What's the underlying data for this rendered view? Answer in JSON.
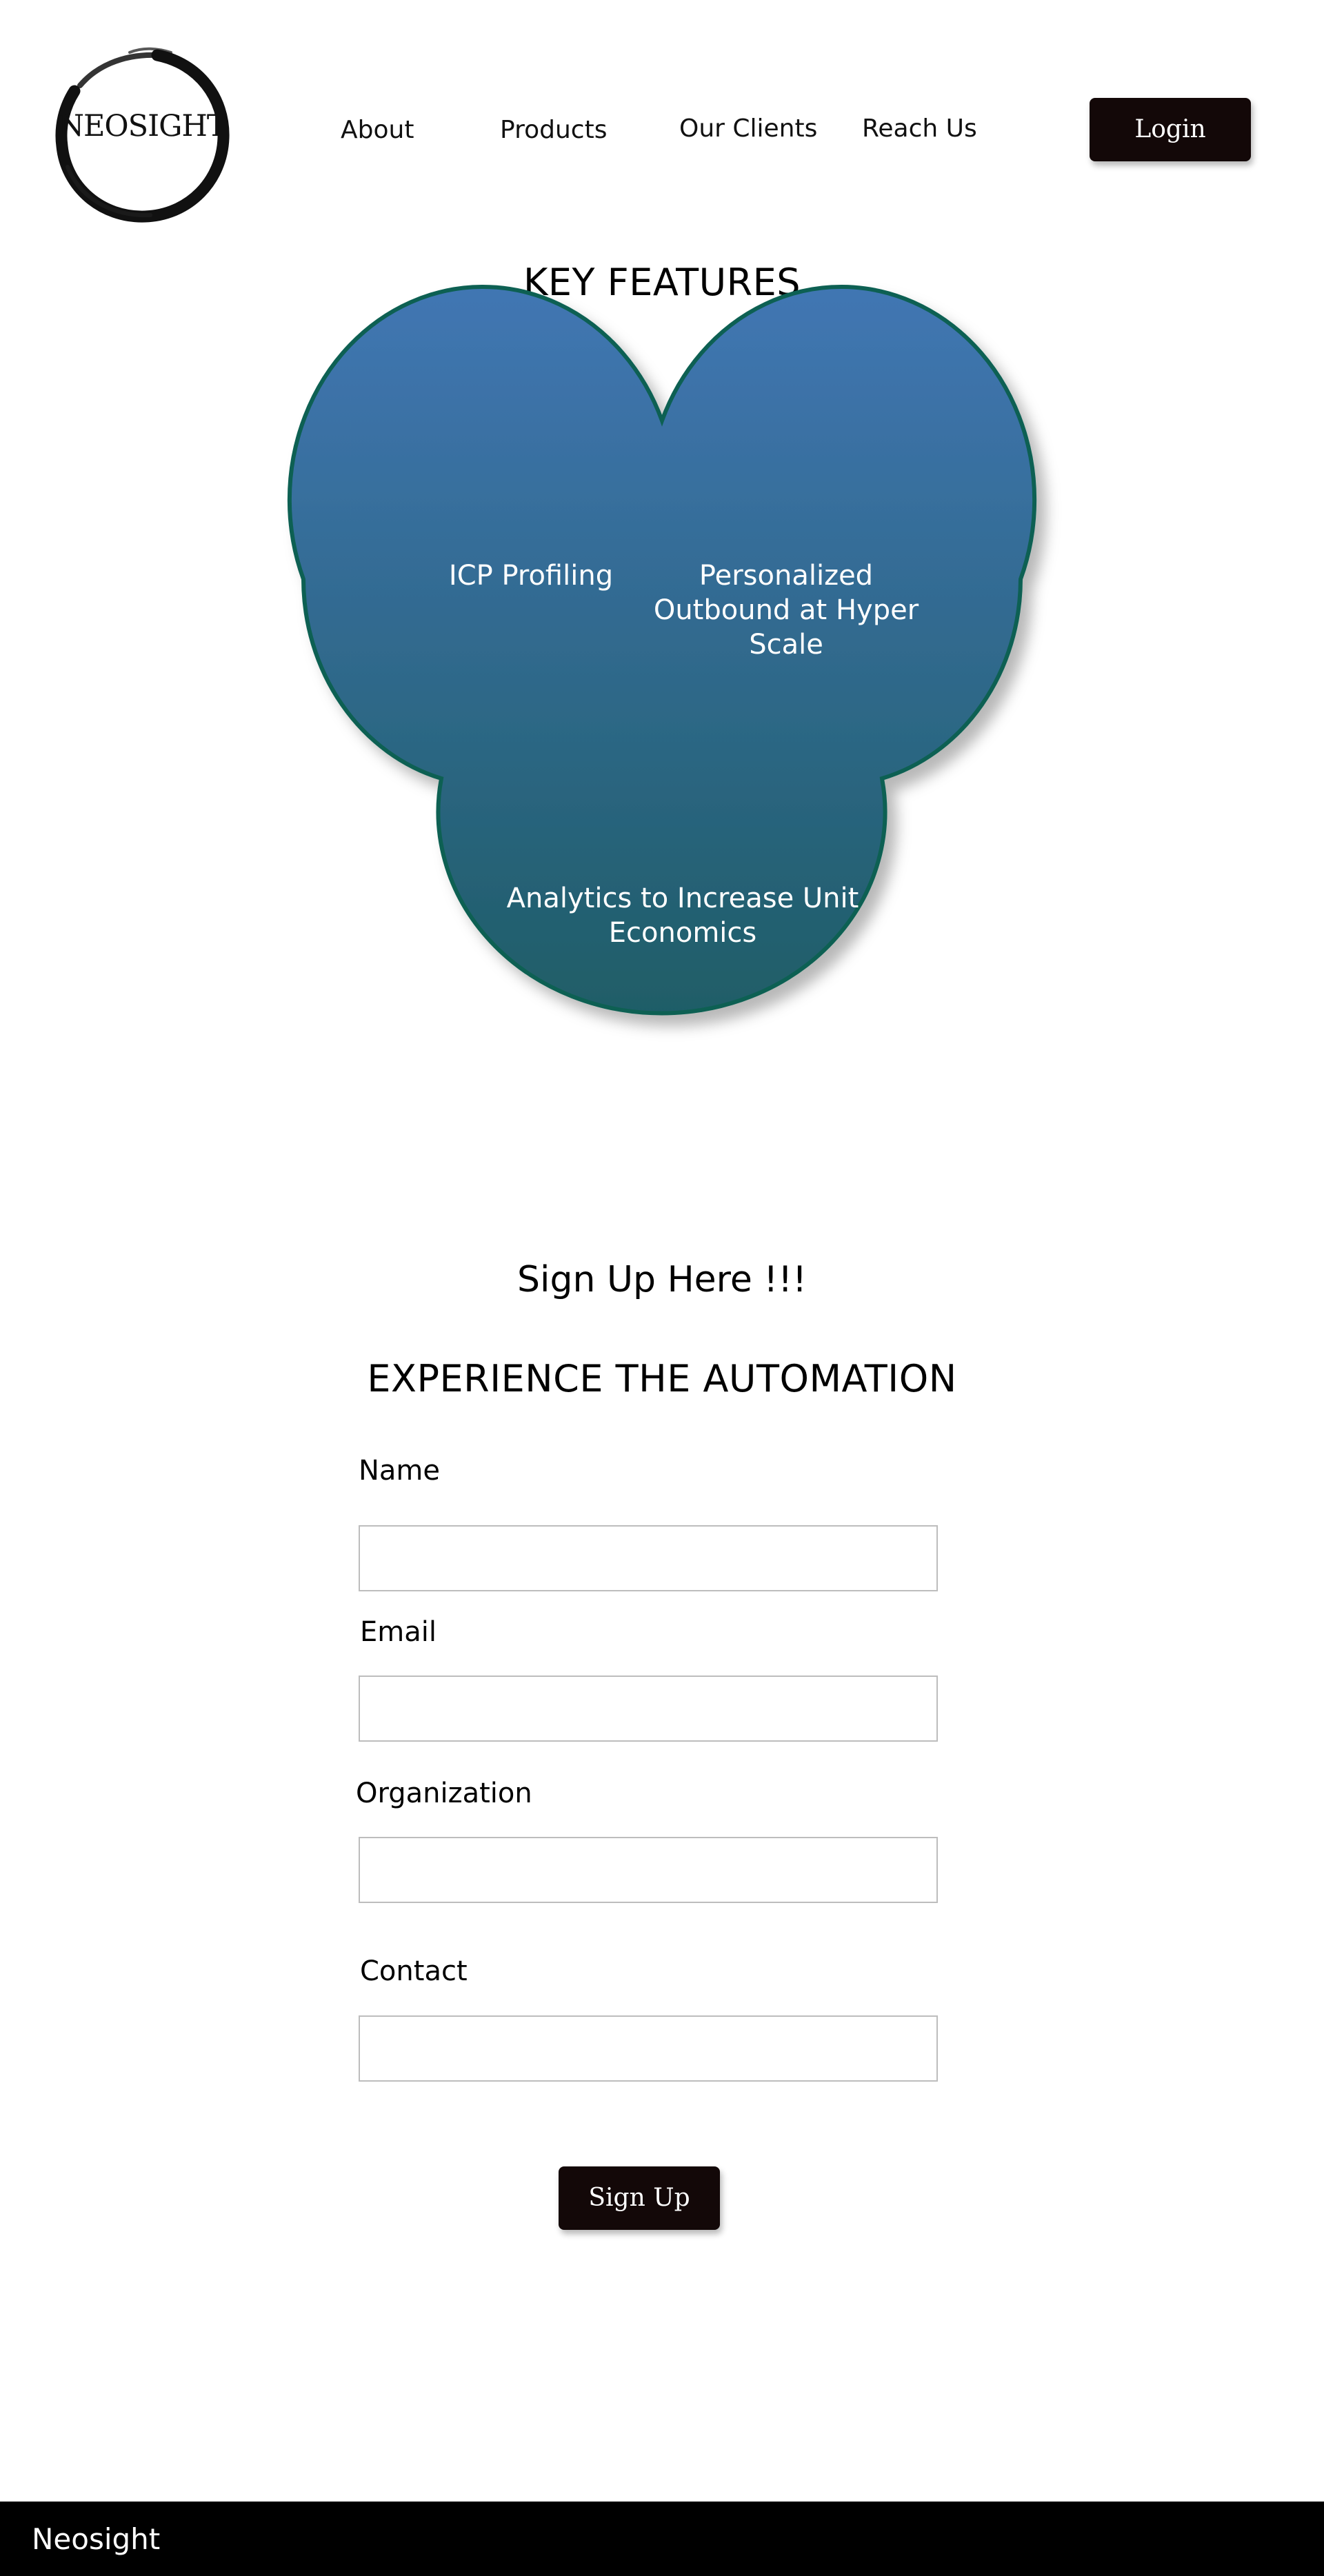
{
  "header": {
    "logo_text": "NEOSIGHT",
    "nav": {
      "about": "About",
      "products": "Products",
      "clients": "Our Clients",
      "reach": "Reach Us"
    },
    "login_label": "Login"
  },
  "features": {
    "title": "KEY FEATURES",
    "items": [
      {
        "label": "ICP Profiling"
      },
      {
        "label": "Personalized Outbound at Hyper Scale"
      },
      {
        "label": "Analytics to Increase Unit Economics"
      }
    ],
    "colors": {
      "fill_top": "#4176b3",
      "fill_bottom": "#1f5d67",
      "stroke": "#0f6152"
    }
  },
  "signup": {
    "heading": "Sign Up Here !!!",
    "subheading": "EXPERIENCE THE AUTOMATION",
    "fields": {
      "name": {
        "label": "Name",
        "value": ""
      },
      "email": {
        "label": "Email",
        "value": ""
      },
      "organization": {
        "label": "Organization",
        "value": ""
      },
      "contact": {
        "label": "Contact",
        "value": ""
      }
    },
    "submit_label": "Sign Up"
  },
  "footer": {
    "text": "Neosight"
  },
  "colors": {
    "button_bg": "#130808",
    "footer_bg": "#000000"
  }
}
